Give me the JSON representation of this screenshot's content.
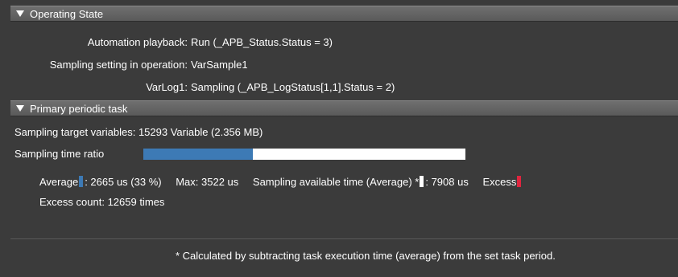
{
  "operating_state": {
    "header": "Operating State",
    "automation_playback_label": "Automation playback",
    "automation_playback_value": "Run (_APB_Status.Status = 3)",
    "sampling_setting_label": "Sampling setting in operation",
    "sampling_setting_value": "VarSample1",
    "varlog_label": "VarLog1",
    "varlog_value": "Sampling (_APB_LogStatus[1,1].Status = 2)"
  },
  "primary_task": {
    "header": "Primary periodic task",
    "target_vars_label": "Sampling target variables",
    "target_vars_value": "15293 Variable (2.356 MB)",
    "time_ratio_label": "Sampling time ratio",
    "time_ratio_fraction": 0.34,
    "average_label": "Average",
    "average_value": "2665 us (33 %)",
    "max_label": "Max",
    "max_value": "3522 us",
    "available_label": "Sampling available time (Average) *",
    "available_value": "7908 us",
    "excess_label": "Excess",
    "excess_count_label": "Excess count",
    "excess_count_value": "12659 times"
  },
  "footnote": "* Calculated by subtracting task execution time (average) from the set task period.",
  "colors": {
    "bar_fill": "#3d7ab5",
    "bar_track": "#ffffff",
    "excess": "#e0253f",
    "background": "#3b3b3b"
  }
}
